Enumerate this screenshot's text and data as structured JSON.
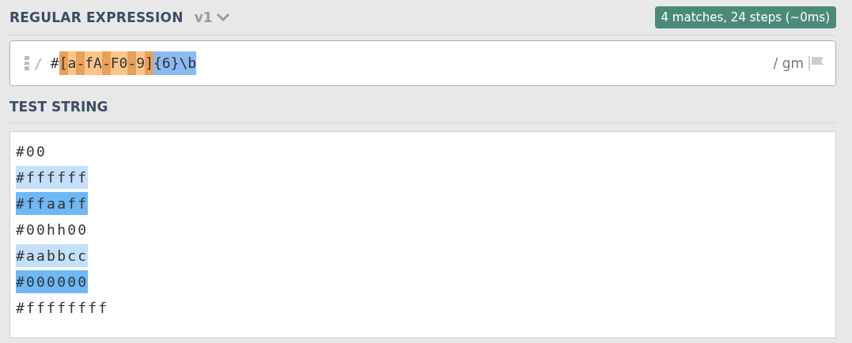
{
  "regex_section": {
    "title": "REGULAR EXPRESSION",
    "version": "v1",
    "match_info": "4 matches, 24 steps (~0ms)",
    "regex": {
      "open_delimiter": "/",
      "tokens": [
        {
          "text": "#",
          "kind": "plain"
        },
        {
          "text": "[",
          "kind": "class-edge"
        },
        {
          "text": "a",
          "kind": "class"
        },
        {
          "text": "-",
          "kind": "class-edge"
        },
        {
          "text": "fA",
          "kind": "class"
        },
        {
          "text": "-",
          "kind": "class-edge"
        },
        {
          "text": "F0",
          "kind": "class"
        },
        {
          "text": "-",
          "kind": "class-edge"
        },
        {
          "text": "9",
          "kind": "class"
        },
        {
          "text": "]",
          "kind": "class-edge"
        },
        {
          "text": "{6}\\b",
          "kind": "quantifier"
        }
      ],
      "flags": "/ gm"
    }
  },
  "test_section": {
    "title": "TEST STRING",
    "lines": [
      {
        "text": "#00",
        "kind": "plain"
      },
      {
        "text": "#ffffff",
        "kind": "odd-match"
      },
      {
        "text": "#ffaaff",
        "kind": "even-match"
      },
      {
        "text": "#00hh00",
        "kind": "plain"
      },
      {
        "text": "#aabbcc",
        "kind": "odd-match"
      },
      {
        "text": "#000000",
        "kind": "even-match"
      },
      {
        "text": "#ffffffff",
        "kind": "plain"
      }
    ]
  }
}
